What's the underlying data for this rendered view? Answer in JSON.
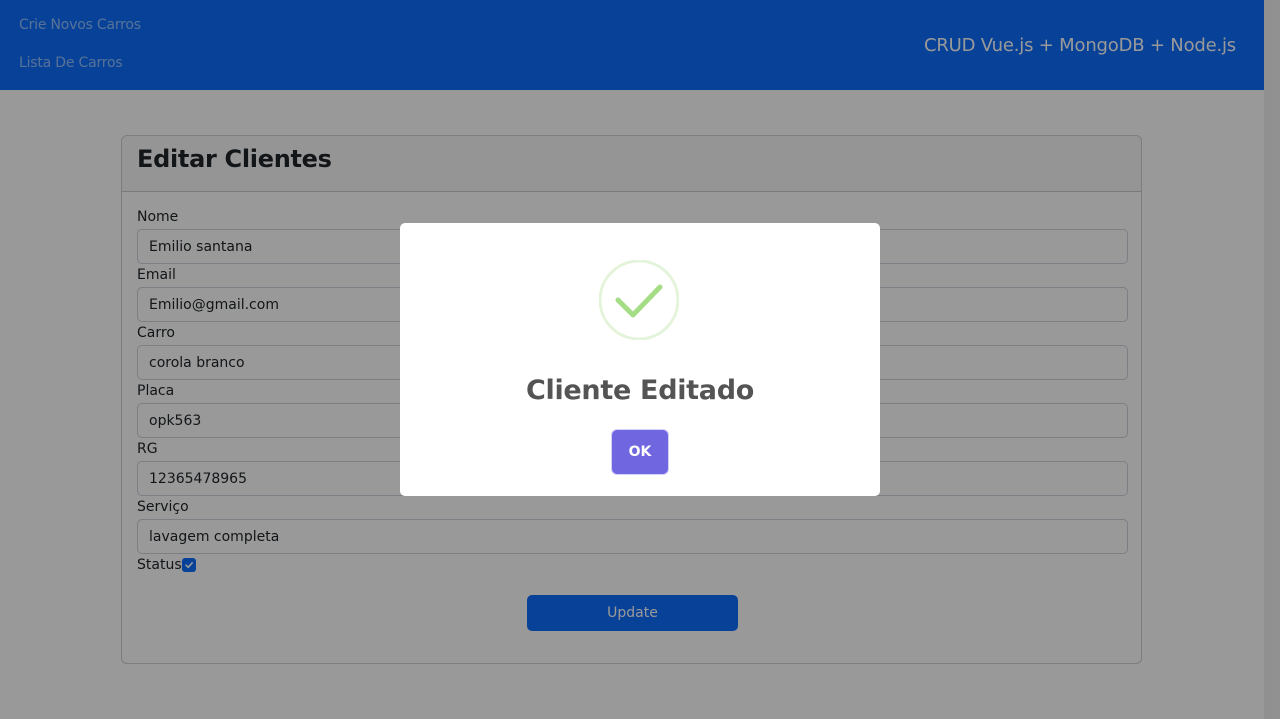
{
  "navbar": {
    "links": [
      "Crie Novos Carros",
      "Lista De Carros"
    ],
    "brand": "CRUD Vue.js + MongoDB + Node.js"
  },
  "form": {
    "title": "Editar Clientes",
    "fields": [
      {
        "label": "Nome",
        "value": "Emilio santana"
      },
      {
        "label": "Email",
        "value": "Emilio@gmail.com"
      },
      {
        "label": "Carro",
        "value": "corola branco"
      },
      {
        "label": "Placa",
        "value": "opk563"
      },
      {
        "label": "RG",
        "value": "12365478965"
      },
      {
        "label": "Serviço",
        "value": "lavagem completa"
      }
    ],
    "status_label": "Status",
    "status_checked": true,
    "submit_label": "Update"
  },
  "modal": {
    "title": "Cliente Editado",
    "confirm_label": "OK",
    "icon": "success-check-icon"
  },
  "colors": {
    "primary": "#0d6efd",
    "overlay": "rgba(0,0,0,0.4)",
    "success": "#a5dc86",
    "confirm": "#7066e0"
  }
}
